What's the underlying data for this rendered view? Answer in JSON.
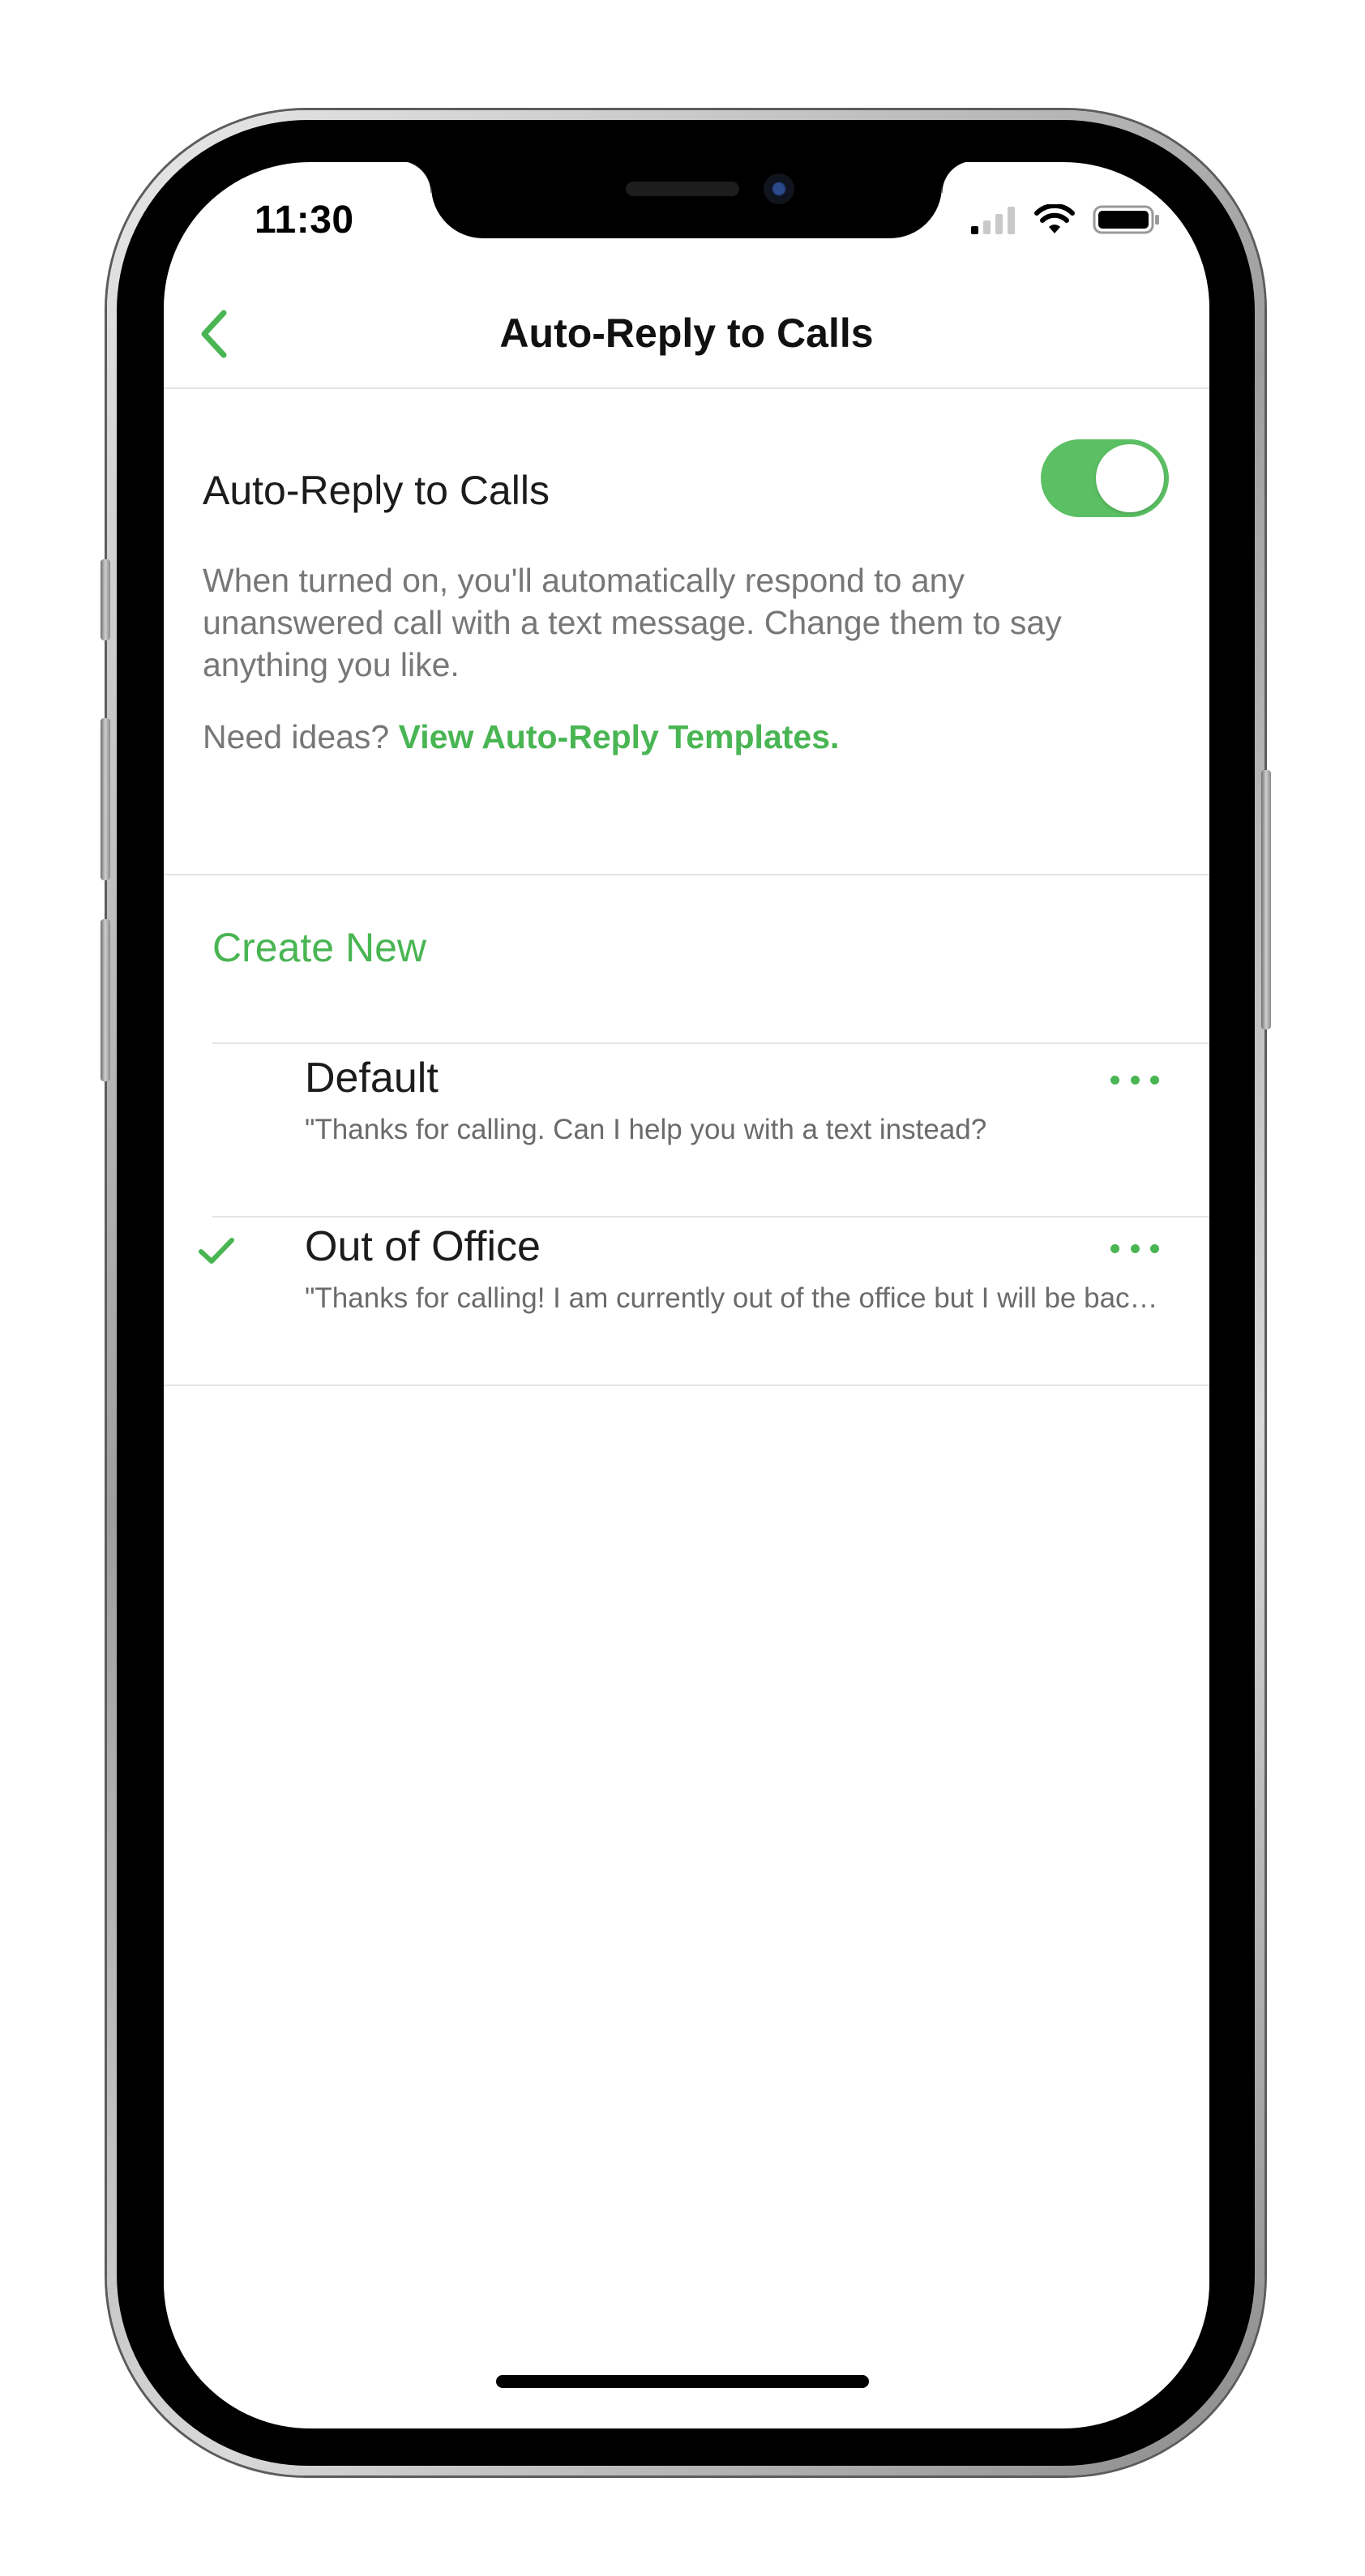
{
  "status_bar": {
    "time": "11:30"
  },
  "nav": {
    "title": "Auto-Reply to Calls",
    "back_icon": "chevron-left-icon"
  },
  "auto_reply": {
    "label": "Auto-Reply to Calls",
    "enabled": true,
    "description": "When turned on, you'll automatically respond to any unanswered call with a text message. Change them to say anything you like.",
    "ideas_prefix": "Need ideas?",
    "ideas_link": "View Auto-Reply Templates."
  },
  "create_new_label": "Create New",
  "replies": [
    {
      "title": "Default",
      "message": "\"Thanks for calling. Can I help you with a text instead?",
      "selected": false
    },
    {
      "title": "Out of Office",
      "message": "\"Thanks for calling! I am currently out of the office but I will be back soon",
      "selected": true
    }
  ],
  "colors": {
    "accent": "#49b553",
    "toggle_on": "#5bbf63"
  }
}
